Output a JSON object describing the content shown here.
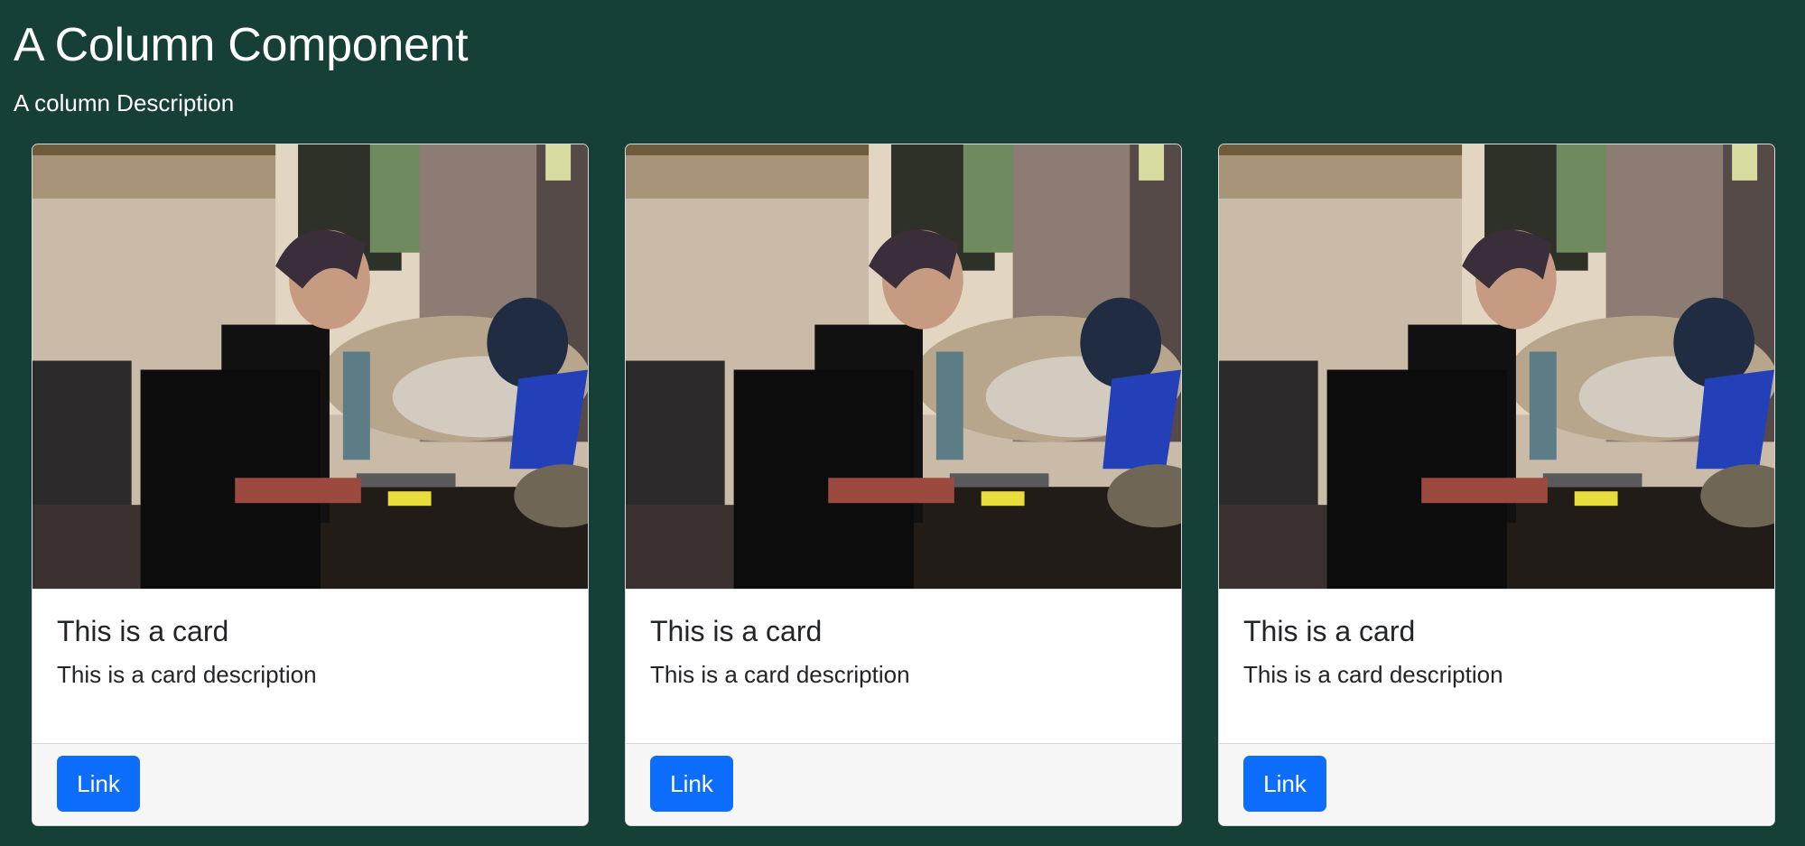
{
  "header": {
    "title": "A Column Component",
    "description": "A column Description"
  },
  "cards": [
    {
      "title": "This is a card",
      "description": "This is a card description",
      "button_label": "Link",
      "image_alt": "Woman working on a laptop"
    },
    {
      "title": "This is a card",
      "description": "This is a card description",
      "button_label": "Link",
      "image_alt": "Woman working on a laptop"
    },
    {
      "title": "This is a card",
      "description": "This is a card description",
      "button_label": "Link",
      "image_alt": "Woman working on a laptop"
    }
  ],
  "colors": {
    "page_background": "#153f37",
    "card_background": "#ffffff",
    "footer_background": "#f7f7f7",
    "button_background": "#0d6efd",
    "button_text": "#ffffff",
    "heading_text": "#212529"
  }
}
